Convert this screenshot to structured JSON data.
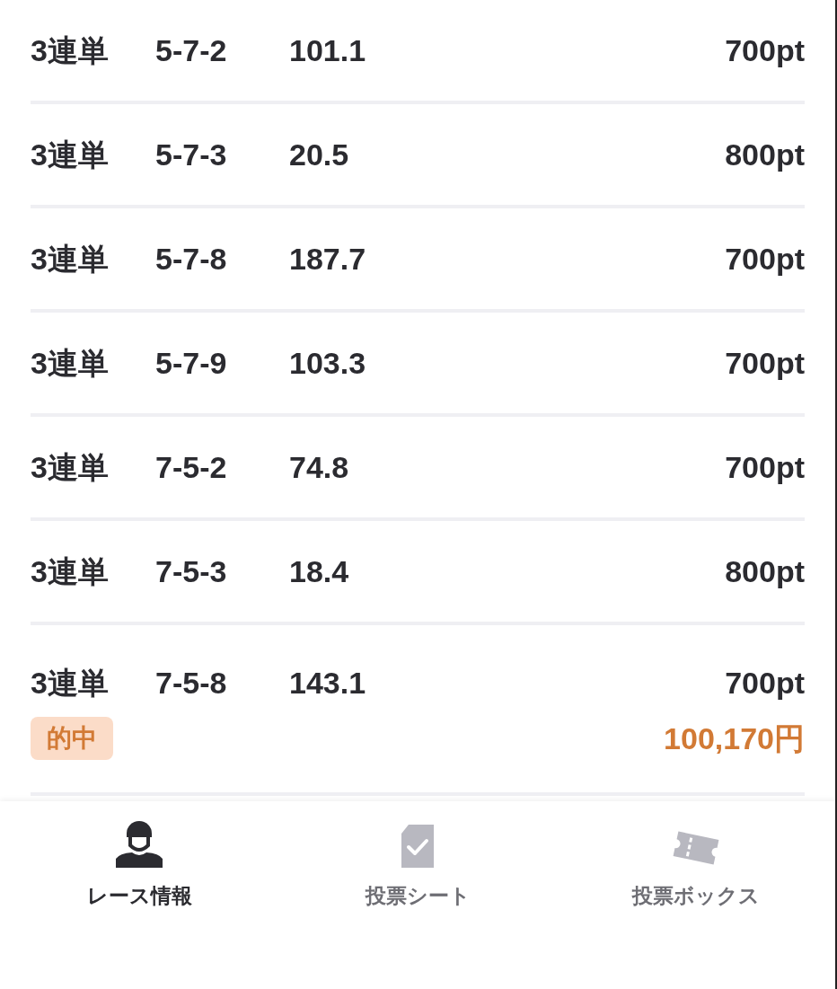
{
  "bets": [
    {
      "type": "3連単",
      "combination": "5-7-2",
      "odds": "101.1",
      "stake": "700pt"
    },
    {
      "type": "3連単",
      "combination": "5-7-3",
      "odds": "20.5",
      "stake": "800pt"
    },
    {
      "type": "3連単",
      "combination": "5-7-8",
      "odds": "187.7",
      "stake": "700pt"
    },
    {
      "type": "3連単",
      "combination": "5-7-9",
      "odds": "103.3",
      "stake": "700pt"
    },
    {
      "type": "3連単",
      "combination": "7-5-2",
      "odds": "74.8",
      "stake": "700pt"
    },
    {
      "type": "3連単",
      "combination": "7-5-3",
      "odds": "18.4",
      "stake": "800pt"
    },
    {
      "type": "3連単",
      "combination": "7-5-8",
      "odds": "143.1",
      "stake": "700pt",
      "result": {
        "badge": "的中",
        "payout": "100,170円"
      }
    }
  ],
  "nav": [
    {
      "kind": "race",
      "label": "レース情報",
      "selected": true
    },
    {
      "kind": "sheet",
      "label": "投票シート",
      "selected": false
    },
    {
      "kind": "box",
      "label": "投票ボックス",
      "selected": false
    }
  ]
}
